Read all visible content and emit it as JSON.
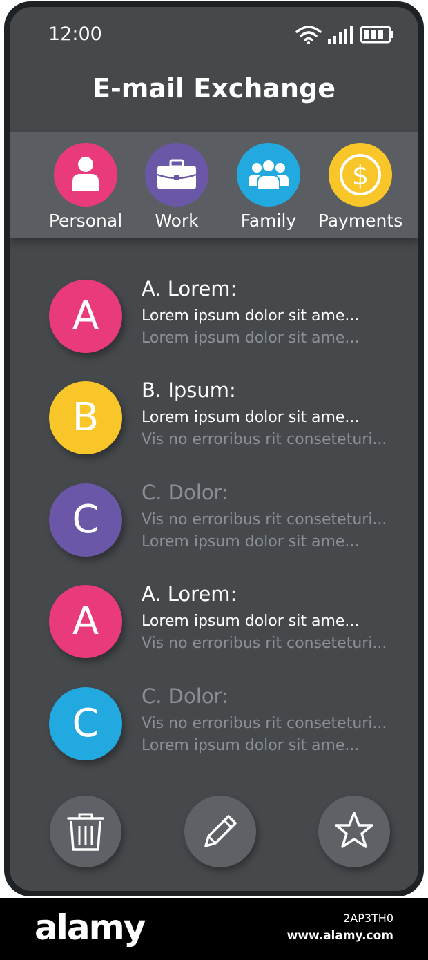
{
  "status_bar": {
    "time": "12:00"
  },
  "header": {
    "title": "E-mail Exchange"
  },
  "categories": [
    {
      "label": "Personal",
      "icon": "person-icon",
      "color": "#e93b7c"
    },
    {
      "label": "Work",
      "icon": "briefcase-icon",
      "color": "#6a57a8"
    },
    {
      "label": "Family",
      "icon": "group-icon",
      "color": "#22a9e0"
    },
    {
      "label": "Payments",
      "icon": "dollar-icon",
      "color": "#f8c629"
    }
  ],
  "messages": [
    {
      "initial": "A",
      "color": "#e93b7c",
      "sender": "A. Lorem:",
      "line1": "Lorem ipsum dolor sit ame...",
      "line2": "Lorem ipsum dolor sit ame...",
      "line1_bright": true
    },
    {
      "initial": "B",
      "color": "#f8c629",
      "sender": "B. Ipsum:",
      "line1": "Lorem ipsum dolor sit ame...",
      "line2": "Vis no erroribus rit conseteturi...",
      "line1_bright": true
    },
    {
      "initial": "C",
      "color": "#6a57a8",
      "sender": "C. Dolor:",
      "line1": "Vis no erroribus rit conseteturi...",
      "line2": "Lorem ipsum dolor sit ame...",
      "line1_bright": false
    },
    {
      "initial": "A",
      "color": "#e93b7c",
      "sender": "A. Lorem:",
      "line1": "Lorem ipsum dolor sit ame...",
      "line2": "Vis no erroribus rit conseteturi...",
      "line1_bright": true
    },
    {
      "initial": "C",
      "color": "#22a9e0",
      "sender": "C. Dolor:",
      "line1": "Vis no erroribus rit conseteturi...",
      "line2": "Lorem ipsum dolor sit ame...",
      "line1_bright": false
    }
  ],
  "actions": [
    {
      "icon": "trash-icon"
    },
    {
      "icon": "pencil-icon"
    },
    {
      "icon": "star-icon"
    }
  ],
  "footer": {
    "logo": "alamy",
    "image_id": "2AP3TH0",
    "site": "www.alamy.com"
  }
}
